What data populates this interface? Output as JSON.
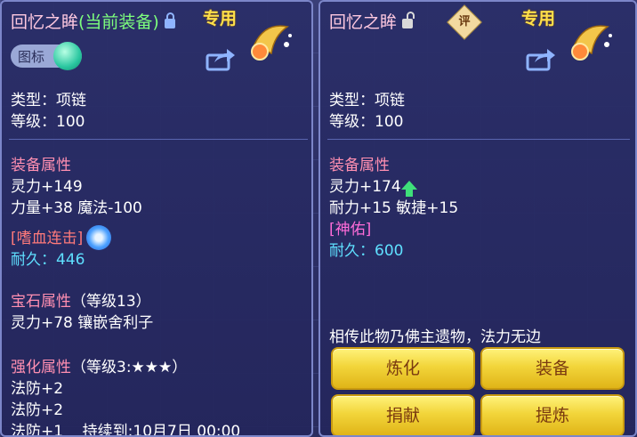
{
  "left": {
    "title": "回忆之眸",
    "title_current": "(当前装备)",
    "exclusive": "专用",
    "icon_toggle_label": "图标",
    "type_line": "类型：项链",
    "level_line": "等级：100",
    "equip_attr_header": "装备属性",
    "attr_lines": [
      "灵力+149",
      "力量+38 魔法-100"
    ],
    "skill_text": "[嗜血连击]",
    "durability": "耐久：446",
    "gem_header": "宝石属性",
    "gem_level": "（等级13）",
    "gem_line": "灵力+78 镶嵌舍利子",
    "enhance_header": "强化属性",
    "enhance_level": "（等级3:★★★）",
    "enhance_lines": [
      "法防+2",
      "法防+2",
      "法防+1    持续到:10月7日 00:00"
    ]
  },
  "right": {
    "title": "回忆之眸",
    "rate_badge": "评",
    "exclusive": "专用",
    "type_line": "类型：项链",
    "level_line": "等级：100",
    "equip_attr_header": "装备属性",
    "attr_line_1": "灵力+174",
    "attr_line_2": "耐力+15 敏捷+15",
    "special_text": "[神佑]",
    "durability": "耐久：600",
    "description": "相传此物乃佛主遗物，法力无边",
    "buttons": [
      "炼化",
      "装备",
      "捐献",
      "提炼"
    ]
  },
  "colors": {
    "panel_border": "#7c86c9",
    "section_header": "#ff8fb1",
    "value_cyan": "#5fe0ff",
    "button_gold": "#f2d53a",
    "exclusive_yellow": "#ffe04a",
    "current_green": "#7dff7d"
  },
  "icons": [
    "lock-icon",
    "unlock-icon",
    "share-icon",
    "exclusive-ornament-icon",
    "skill-swirl-icon",
    "up-arrow-icon"
  ]
}
